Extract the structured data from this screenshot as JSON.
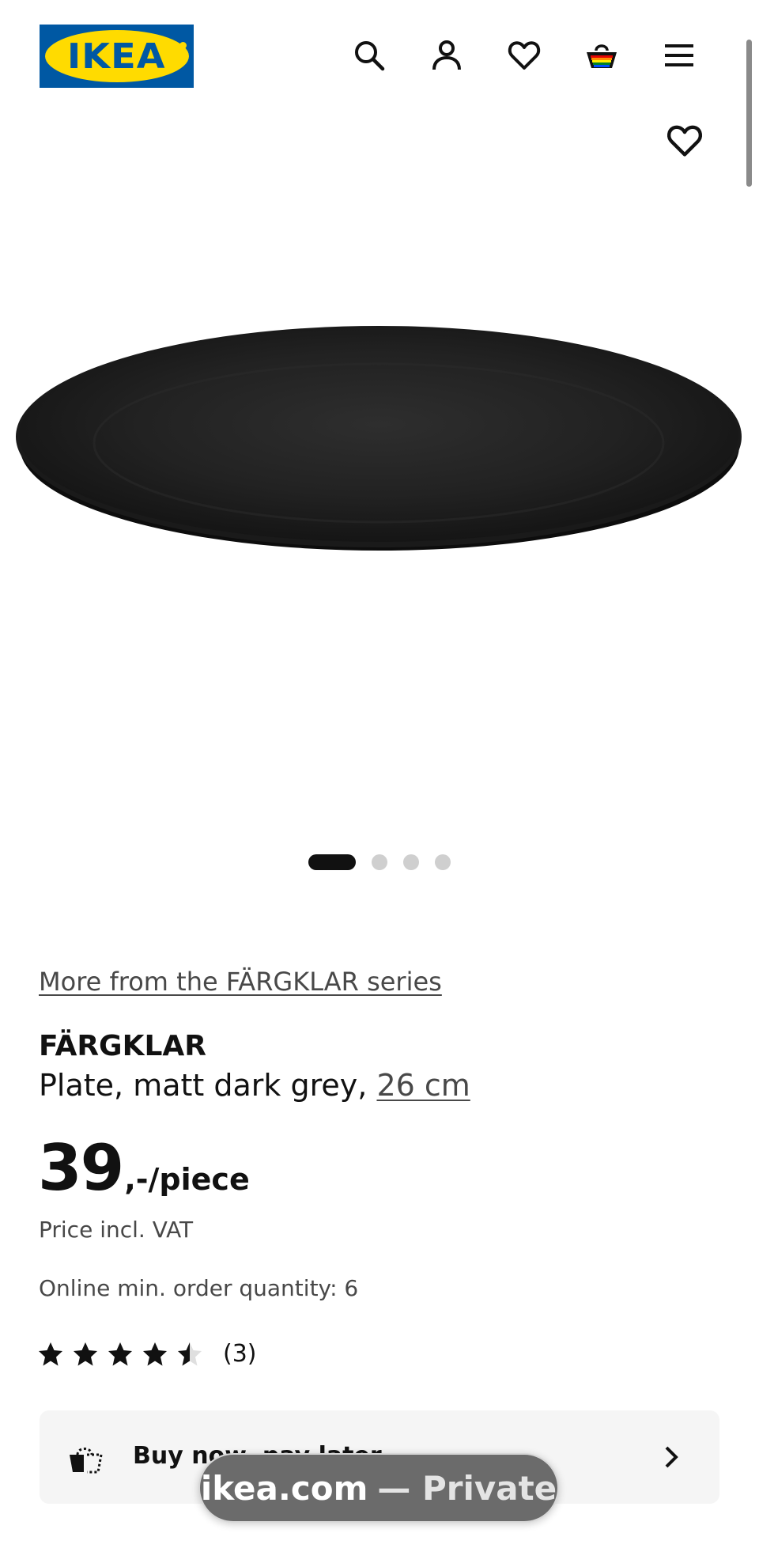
{
  "header": {
    "logo_text": "IKEA",
    "icons": [
      "search-icon",
      "account-icon",
      "favourites-icon",
      "shopping-bag-icon",
      "menu-icon"
    ]
  },
  "product": {
    "series_link": "More from the FÄRGKLAR series",
    "name": "FÄRGKLAR",
    "description": "Plate, matt dark grey,",
    "size_link": "26 cm",
    "price_integer": "39",
    "price_suffix": ",-/piece",
    "vat_note": "Price incl. VAT",
    "min_order": "Online min. order quantity: 6",
    "rating": 4.5,
    "rating_max": 5,
    "rating_count": "(3)",
    "image_count": 4,
    "active_image": 1
  },
  "buy_now": {
    "label": "Buy now, pay later"
  },
  "browser": {
    "domain": "ikea.com",
    "mode": "— Private"
  },
  "colors": {
    "ikea_blue": "#0058a3",
    "ikea_yellow": "#ffdb00",
    "text_primary": "#111111",
    "text_secondary": "#484848"
  }
}
